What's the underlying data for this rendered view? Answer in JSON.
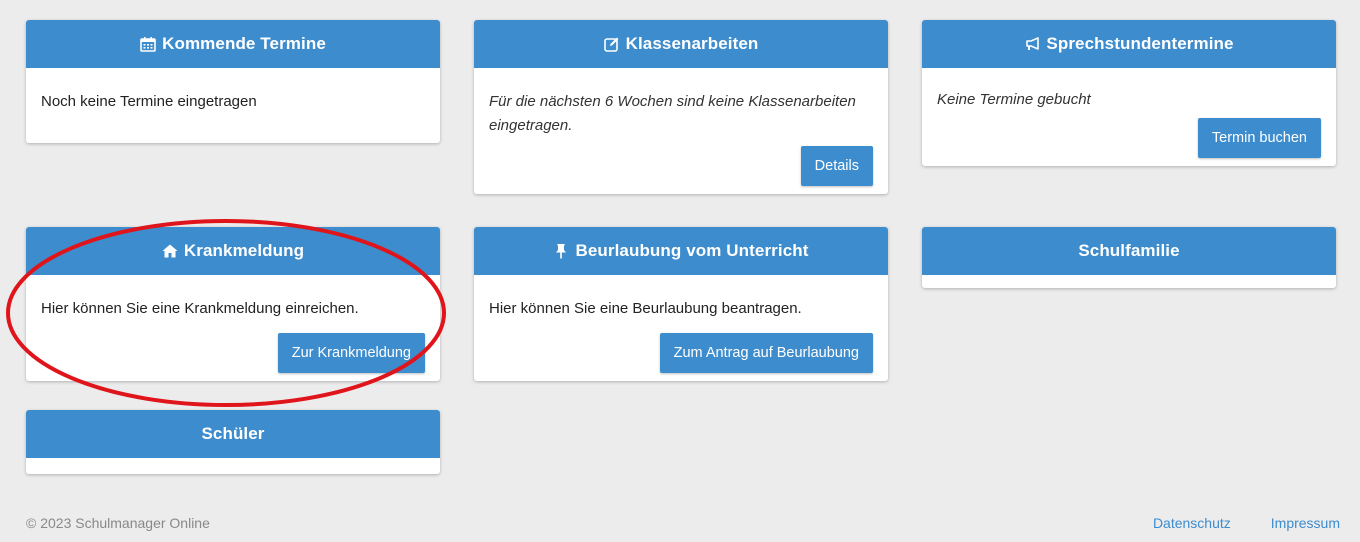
{
  "cards": {
    "termine": {
      "title": "Kommende Termine",
      "text": "Noch keine Termine eingetragen"
    },
    "klassenarbeiten": {
      "title": "Klassenarbeiten",
      "text": "Für die nächsten 6 Wochen sind keine Klassenarbeiten eingetragen.",
      "button": "Details"
    },
    "sprechstunden": {
      "title": "Sprechstundentermine",
      "text": "Keine Termine gebucht",
      "button": "Termin buchen"
    },
    "krankmeldung": {
      "title": "Krankmeldung",
      "text": "Hier können Sie eine Krankmeldung einreichen.",
      "button": "Zur Krankmeldung"
    },
    "beurlaubung": {
      "title": "Beurlaubung vom Unterricht",
      "text": "Hier können Sie eine Beurlaubung beantragen.",
      "button": "Zum Antrag auf Beurlaubung"
    },
    "schulfamilie": {
      "title": "Schulfamilie"
    },
    "schueler": {
      "title": "Schüler"
    }
  },
  "footer": {
    "copyright": "© 2023 Schulmanager Online",
    "links": [
      "Datenschutz",
      "Impressum"
    ]
  },
  "colors": {
    "accent": "#3d8ccd",
    "background": "#ececec",
    "annotation": "#e0141b"
  },
  "icons": {
    "termine": "calendar-icon",
    "klassenarbeiten": "edit-icon",
    "sprechstunden": "megaphone-icon",
    "krankmeldung": "home-icon",
    "beurlaubung": "pushpin-icon"
  }
}
